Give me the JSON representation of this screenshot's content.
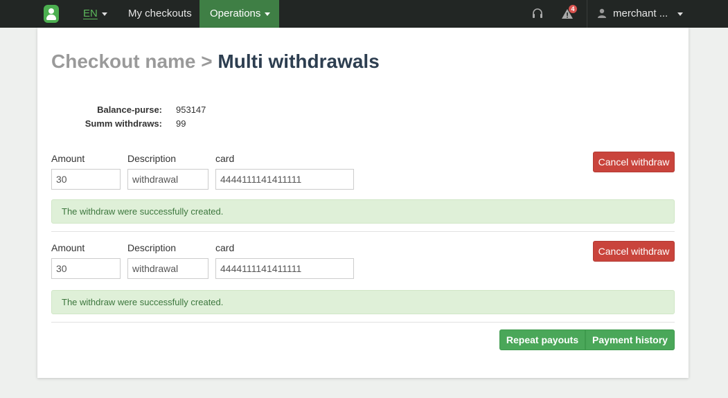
{
  "navbar": {
    "lang": "EN",
    "my_checkouts": "My checkouts",
    "operations": "Operations",
    "alert_count": "4",
    "user": "merchant ..."
  },
  "page": {
    "crumb": "Checkout name",
    "separator": ">",
    "title": "Multi withdrawals"
  },
  "info": {
    "balance_label": "Balance-purse:",
    "balance_value": "953147",
    "summ_label": "Summ withdraws:",
    "summ_value": "99"
  },
  "withdrawals": [
    {
      "amount_label": "Amount",
      "amount": "30",
      "description_label": "Description",
      "description": "withdrawal",
      "card_label": "card",
      "card": "4444111141411111",
      "cancel_label": "Cancel withdraw",
      "message": "The withdraw were successfully created."
    },
    {
      "amount_label": "Amount",
      "amount": "30",
      "description_label": "Description",
      "description": "withdrawal",
      "card_label": "card",
      "card": "4444111141411111",
      "cancel_label": "Cancel withdraw",
      "message": "The withdraw were successfully created."
    }
  ],
  "actions": {
    "repeat": "Repeat payouts",
    "history": "Payment history"
  },
  "colors": {
    "navbar": "#222624",
    "active_nav": "#3f7f45",
    "danger": "#c9443c",
    "success": "#4aa759",
    "alert_bg": "#dff0d8",
    "alert_text": "#3c763d"
  }
}
